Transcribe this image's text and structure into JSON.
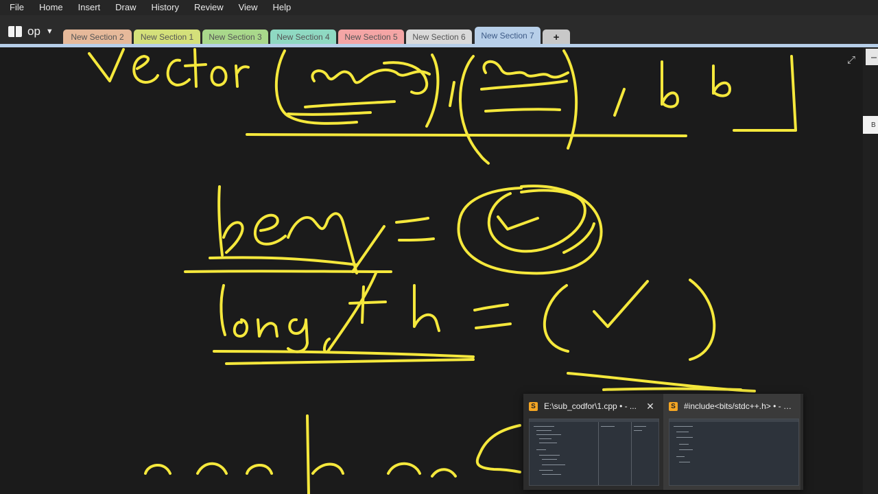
{
  "menu": [
    "File",
    "Home",
    "Insert",
    "Draw",
    "History",
    "Review",
    "View",
    "Help"
  ],
  "notebook": {
    "name": "op"
  },
  "tabs": [
    {
      "label": "New Section 2",
      "color": "#e6b99a"
    },
    {
      "label": "New Section 1",
      "color": "#d4e07a"
    },
    {
      "label": "New Section 3",
      "color": "#a9d88b"
    },
    {
      "label": "New Section 4",
      "color": "#8fd9c2"
    },
    {
      "label": "New Section 5",
      "color": "#f4a5a5"
    },
    {
      "label": "New Section 6",
      "color": "#d9d9d9"
    },
    {
      "label": "New Section 7",
      "color": "#b7cfe9"
    },
    {
      "label": "+",
      "color": "#c8c8c8"
    }
  ],
  "ink_color": "#f5e83c",
  "right_panel": {
    "letter": "B"
  },
  "taskbar_preview": [
    {
      "title": "E:\\sub_codfor\\1.cpp • - ...",
      "app_icon": "sublime-text-icon",
      "has_close": true
    },
    {
      "title": "#include<bits/stdc++.h> • - Subl...",
      "app_icon": "sublime-text-icon",
      "has_close": false
    }
  ]
}
